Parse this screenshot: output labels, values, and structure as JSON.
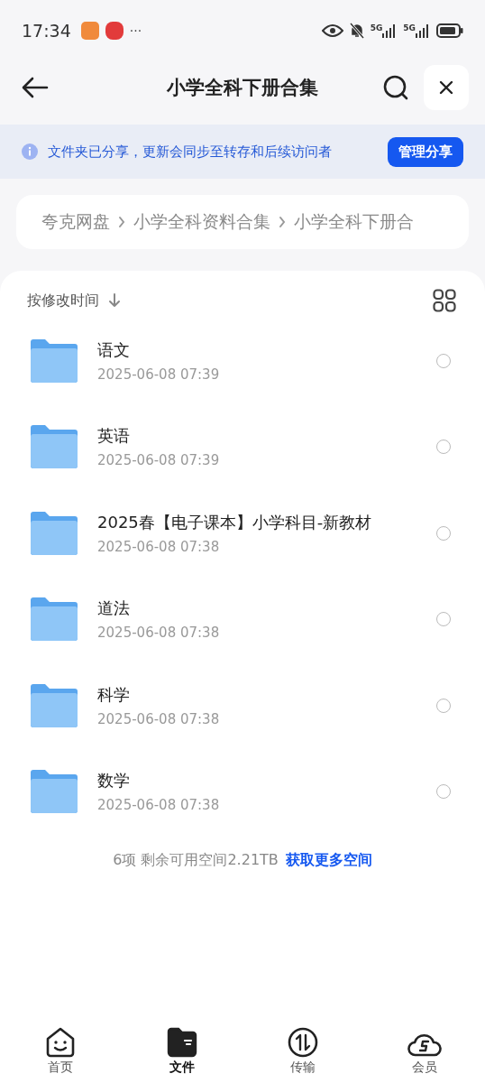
{
  "status_bar": {
    "time": "17:34",
    "more": "···",
    "network_1": "5G",
    "network_2": "5G"
  },
  "header": {
    "title": "小学全科下册合集"
  },
  "share_notice": {
    "text": "文件夹已分享，更新会同步至转存和后续访问者",
    "button": "管理分享"
  },
  "breadcrumb": [
    "夸克网盘",
    "小学全科资料合集",
    "小学全科下册合"
  ],
  "sort": {
    "label": "按修改时间"
  },
  "files": [
    {
      "name": "语文",
      "date": "2025-06-08 07:39",
      "checked": false
    },
    {
      "name": "英语",
      "date": "2025-06-08 07:39",
      "checked": false
    },
    {
      "name": "2025春【电子课本】小学科目-新教材",
      "date": "2025-06-08 07:38",
      "checked": false
    },
    {
      "name": "道法",
      "date": "2025-06-08 07:38",
      "checked": false
    },
    {
      "name": "科学",
      "date": "2025-06-08 07:38",
      "checked": false
    },
    {
      "name": "数学",
      "date": "2025-06-08 07:38",
      "checked": false
    }
  ],
  "footer": {
    "summary": "6项 剩余可用空间2.21TB",
    "link": "获取更多空间"
  },
  "tabs": [
    {
      "label": "首页",
      "kind": "home",
      "selected": false
    },
    {
      "label": "文件",
      "kind": "files",
      "selected": true
    },
    {
      "label": "传输",
      "kind": "transfer",
      "selected": false
    },
    {
      "label": "会员",
      "kind": "cloud",
      "selected": false
    }
  ]
}
